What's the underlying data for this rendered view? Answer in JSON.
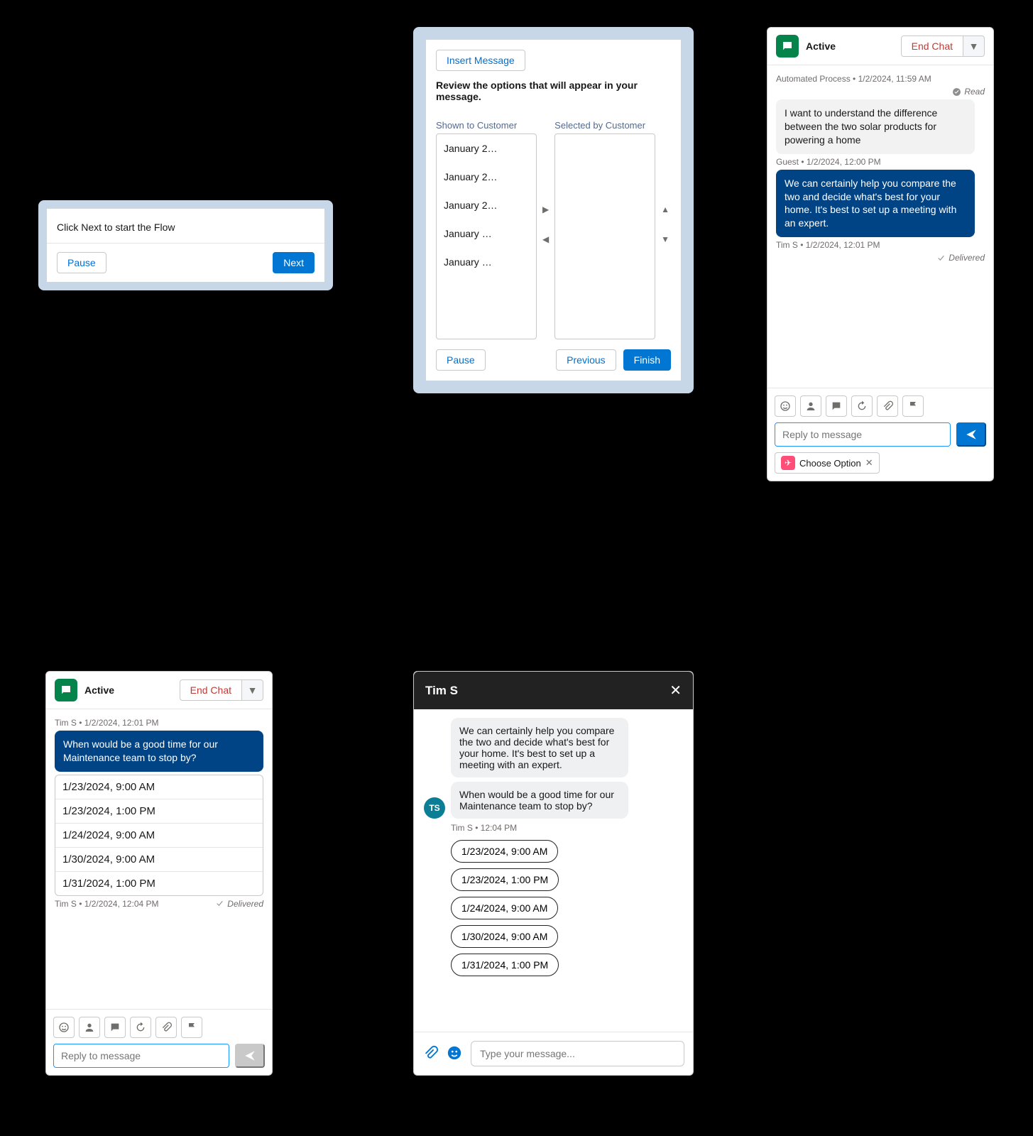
{
  "panel1": {
    "body": "Click Next to start the Flow",
    "pause": "Pause",
    "next": "Next"
  },
  "panel2": {
    "insert": "Insert Message",
    "heading": "Review the options that will appear in your message.",
    "shown_label": "Shown to Customer",
    "selected_label": "Selected by Customer",
    "shown_items": [
      "January 2…",
      "January 2…",
      "January 2…",
      "January …",
      "January …"
    ],
    "pause": "Pause",
    "previous": "Previous",
    "finish": "Finish"
  },
  "agent_chat": {
    "status": "Active",
    "end": "End Chat",
    "auto_meta": "Automated Process • 1/2/2024, 11:59 AM",
    "read": "Read",
    "guest_msg": "I want to understand the difference between the two solar products for powering a home",
    "guest_meta": "Guest • 1/2/2024, 12:00 PM",
    "agent_msg": "We can certainly help you compare the two and decide what's best for your home. It's best to set up a meeting with an expert.",
    "agent_meta": "Tim S • 1/2/2024, 12:01 PM",
    "delivered": "Delivered",
    "reply_placeholder": "Reply to message",
    "chip_label": "Choose Option"
  },
  "agent_chat2": {
    "status": "Active",
    "end": "End Chat",
    "auto_meta": "Tim S • 1/2/2024, 12:01 PM",
    "prompt_msg": "When would be a good time for our Maintenance team to stop by?",
    "options": [
      "1/23/2024, 9:00 AM",
      "1/23/2024, 1:00 PM",
      "1/24/2024, 9:00 AM",
      "1/30/2024, 9:00 AM",
      "1/31/2024, 1:00 PM"
    ],
    "prompt_meta": "Tim S • 1/2/2024, 12:04 PM",
    "delivered": "Delivered",
    "reply_placeholder": "Reply to message"
  },
  "customer": {
    "title": "Tim S",
    "msg1": "We can certainly help you compare the two and decide what's best for your home. It's best to set up a meeting with an expert.",
    "msg2": "When would be a good time for our Maintenance team to stop by?",
    "meta": "Tim S • 12:04 PM",
    "options": [
      "1/23/2024, 9:00 AM",
      "1/23/2024, 1:00 PM",
      "1/24/2024, 9:00 AM",
      "1/30/2024, 9:00 AM",
      "1/31/2024, 1:00 PM"
    ],
    "input_placeholder": "Type your message...",
    "avatar": "TS"
  },
  "icons": {
    "emoji": "emoji-icon",
    "person": "person-icon",
    "chat": "chat-icon",
    "refresh": "refresh-icon",
    "attach": "attach-icon",
    "flag": "flag-icon"
  }
}
